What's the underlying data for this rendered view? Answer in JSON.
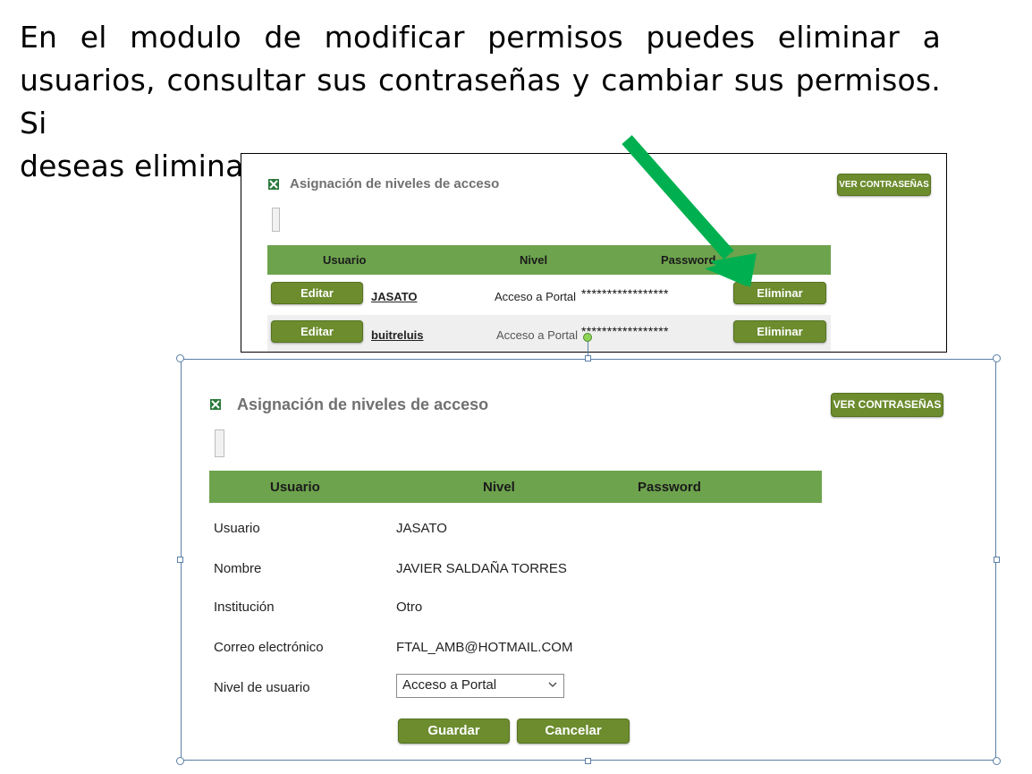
{
  "instruction": {
    "line1": "En el modulo de modificar permisos puedes eliminar a",
    "line2": "usuarios, consultar sus contraseñas y cambiar sus permisos. Si",
    "line3": "deseas eliminar, solo haz clic en “Eliminar”"
  },
  "list_view": {
    "title": "Asignación de niveles de acceso",
    "ver_btn": "VER CONTRASEÑAS",
    "headers": {
      "usuario": "Usuario",
      "nivel": "Nivel",
      "password": "Password"
    },
    "rows": [
      {
        "edit": "Editar",
        "user": "JASATO",
        "nivel": "Acceso a Portal",
        "password": "*****************",
        "delete": "Eliminar"
      },
      {
        "edit": "Editar",
        "user": "buitreluis",
        "nivel": "Acceso a Portal",
        "password": "*****************",
        "delete": "Eliminar"
      }
    ]
  },
  "edit_view": {
    "title": "Asignación de niveles de acceso",
    "ver_btn": "VER CONTRASEÑAS",
    "headers": {
      "usuario": "Usuario",
      "nivel": "Nivel",
      "password": "Password"
    },
    "fields": [
      {
        "label": "Usuario",
        "value": "JASATO"
      },
      {
        "label": "Nombre",
        "value": "JAVIER SALDAÑA TORRES"
      },
      {
        "label": "Institución",
        "value": "Otro"
      },
      {
        "label": "Correo electrónico",
        "value": "FTAL_AMB@HOTMAIL.COM"
      }
    ],
    "nivel_label": "Nivel de usuario",
    "nivel_selected": "Acceso a Portal",
    "save_btn": "Guardar",
    "cancel_btn": "Cancelar"
  },
  "colors": {
    "button_green": "#6c8c2e",
    "header_green": "#6da34d",
    "arrow_green": "#00b050",
    "selection_border": "#5b7fa6"
  },
  "icons": [
    "excel-icon",
    "chevron-down-icon",
    "arrow-pointer"
  ]
}
